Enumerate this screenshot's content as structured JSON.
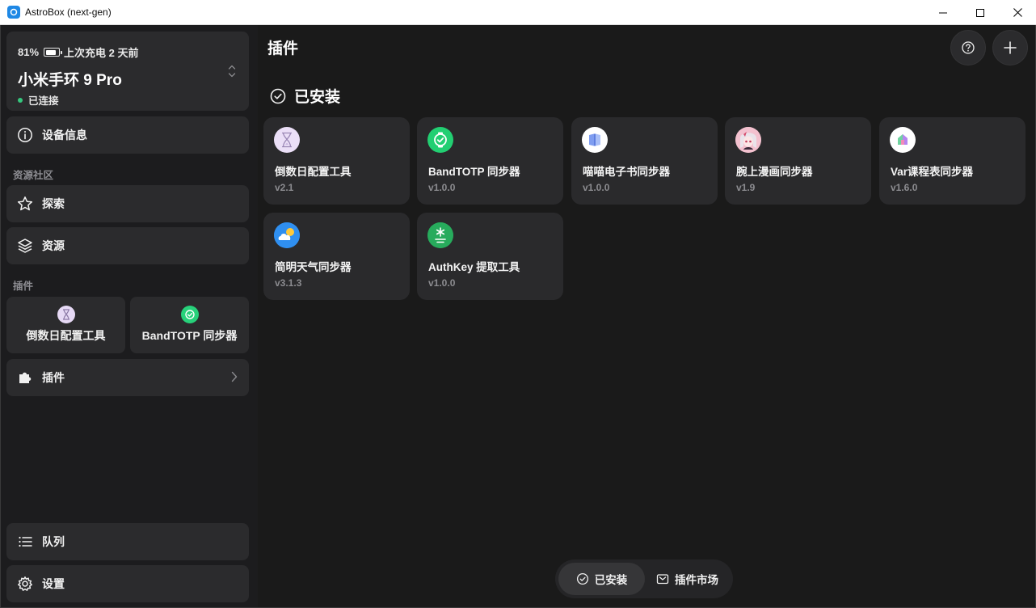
{
  "window": {
    "title": "AstroBox (next-gen)"
  },
  "device": {
    "battery": "81%",
    "battery_level": 0.81,
    "last_charge": "上次充电 2 天前",
    "name": "小米手环 9 Pro",
    "status": "已连接",
    "status_color": "#35c77d"
  },
  "sidebar": {
    "device_info": "设备信息",
    "community_label": "资源社区",
    "explore": "探索",
    "resources": "资源",
    "plugins_label": "插件",
    "pinned_plugins": [
      {
        "label": "倒数日配置工具",
        "icon": "hourglass-icon"
      },
      {
        "label": "BandTOTP 同步器",
        "icon": "watch-check-icon"
      }
    ],
    "plugins": "插件",
    "queue": "队列",
    "settings": "设置"
  },
  "main": {
    "title": "插件",
    "section": "已安装",
    "cards": [
      {
        "name": "倒数日配置工具",
        "version": "v2.1",
        "icon": "hourglass-icon"
      },
      {
        "name": "BandTOTP 同步器",
        "version": "v1.0.0",
        "icon": "watch-check-icon"
      },
      {
        "name": "喵喵电子书同步器",
        "version": "v1.0.0",
        "icon": "book-icon"
      },
      {
        "name": "腕上漫画同步器",
        "version": "v1.9",
        "icon": "anime-avatar-icon"
      },
      {
        "name": "Var课程表同步器",
        "version": "v1.6.0",
        "icon": "schedule-icon"
      },
      {
        "name": "简明天气同步器",
        "version": "v3.1.3",
        "icon": "weather-icon"
      },
      {
        "name": "AuthKey 提取工具",
        "version": "v1.0.0",
        "icon": "key-extract-icon"
      }
    ]
  },
  "tabs": {
    "installed": "已安装",
    "market": "插件市场"
  },
  "colors": {
    "background": "#1a1a1a",
    "card": "#2a2a2c",
    "accent_green": "#35c77d"
  }
}
